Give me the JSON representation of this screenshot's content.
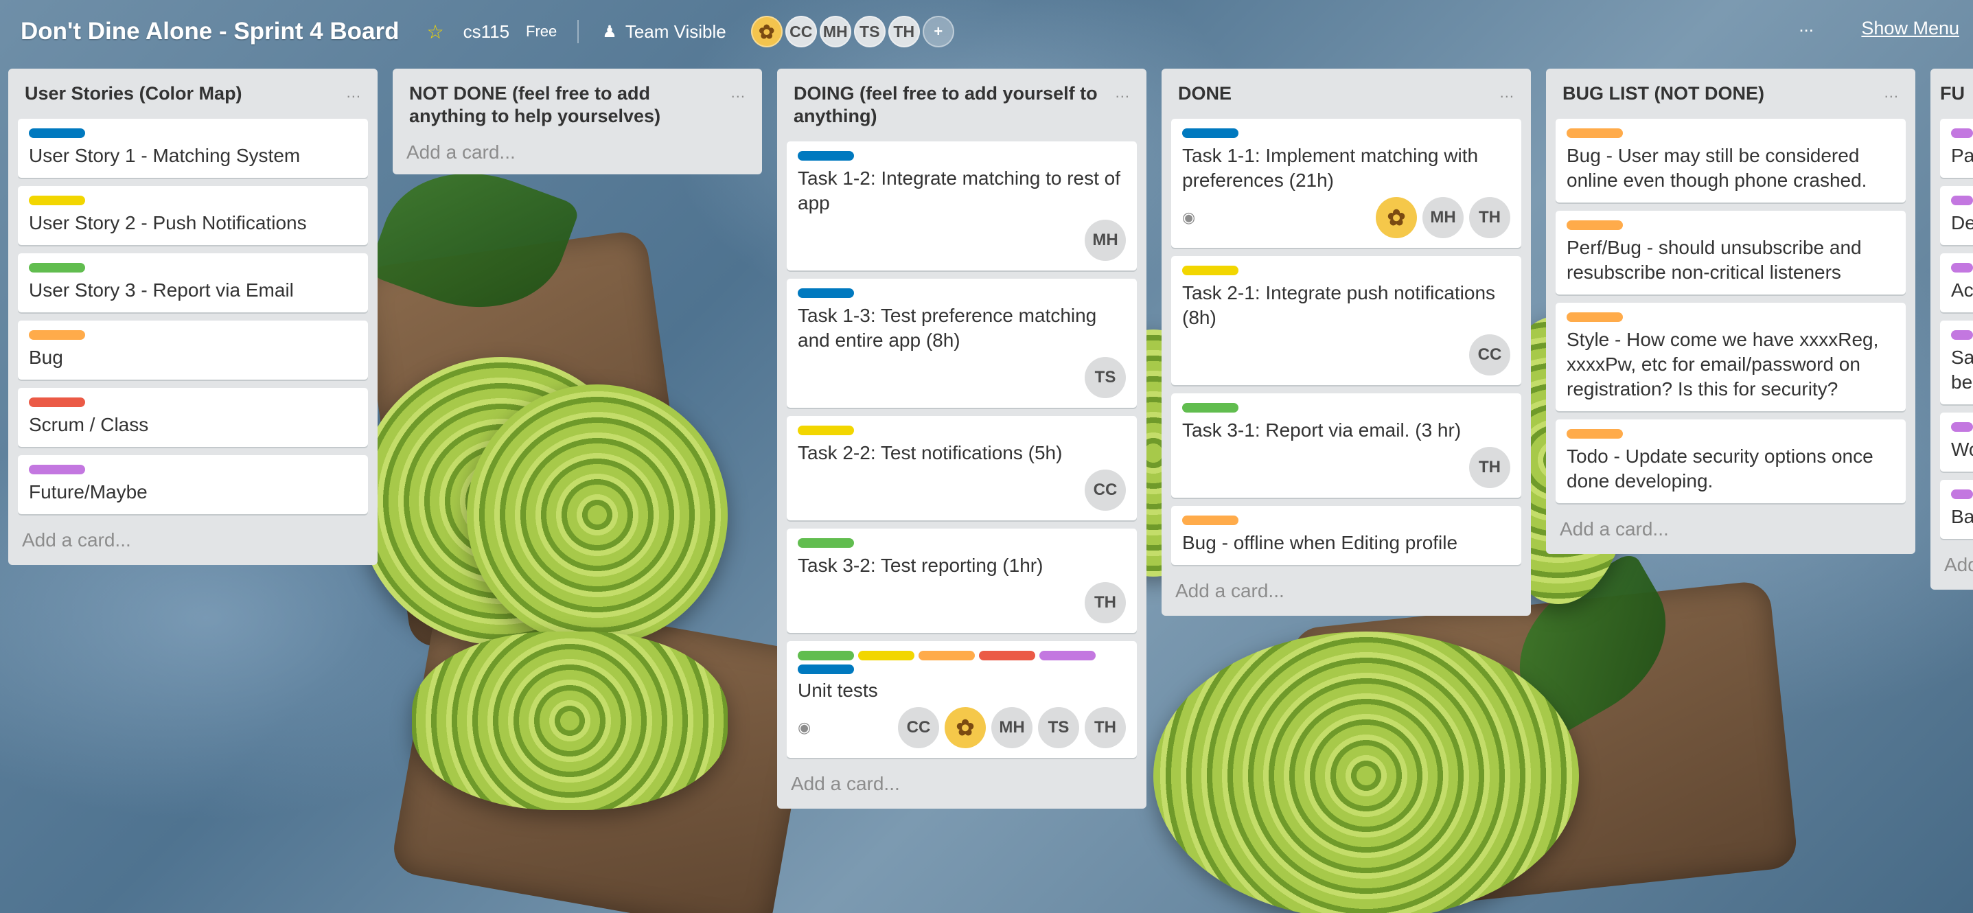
{
  "header": {
    "board_title": "Don't Dine Alone - Sprint 4 Board",
    "team_name": "cs115",
    "plan_badge": "Free",
    "visibility": "Team Visible",
    "menu_dots": "...",
    "show_menu": "Show Menu",
    "members": [
      "CC",
      "MH",
      "TS",
      "TH"
    ]
  },
  "colors": {
    "blue": "#0079bf",
    "yellow": "#f2d600",
    "green": "#61bd4f",
    "orange": "#ffab4a",
    "red": "#eb5a46",
    "purple": "#c377e0"
  },
  "lists": [
    {
      "title": "User Stories (Color Map)",
      "menu": "...",
      "add_card": "Add a card...",
      "cards": [
        {
          "title": "User Story 1 - Matching System"
        },
        {
          "title": "User Story 2 - Push Notifications"
        },
        {
          "title": "User Story 3 - Report via Email"
        },
        {
          "title": "Bug"
        },
        {
          "title": "Scrum / Class"
        },
        {
          "title": "Future/Maybe"
        }
      ]
    },
    {
      "title": "NOT DONE (feel free to add anything to help yourselves)",
      "menu": "...",
      "add_card": "Add a card..."
    },
    {
      "title": "DOING (feel free to add yourself to anything)",
      "menu": "...",
      "add_card": "Add a card...",
      "cards": [
        {
          "title": "Task 1-2: Integrate matching to rest of app",
          "members": [
            "MH"
          ]
        },
        {
          "title": "Task 1-3: Test preference matching and entire app (8h)",
          "members": [
            "TS"
          ]
        },
        {
          "title": "Task 2-2: Test notifications (5h)",
          "members": [
            "CC"
          ]
        },
        {
          "title": "Task 3-2: Test reporting (1hr)",
          "members": [
            "TH"
          ]
        },
        {
          "title": "Unit tests",
          "members": [
            "CC",
            "MH",
            "TS",
            "TH"
          ]
        }
      ]
    },
    {
      "title": "DONE",
      "menu": "...",
      "add_card": "Add a card...",
      "cards": [
        {
          "title": "Task 1-1: Implement matching with preferences (21h)",
          "members": [
            "MH",
            "TH"
          ]
        },
        {
          "title": "Task 2-1: Integrate push notifications (8h)",
          "members": [
            "CC"
          ]
        },
        {
          "title": "Task 3-1: Report via email. (3 hr)",
          "members": [
            "TH"
          ]
        },
        {
          "title": "Bug - offline when Editing profile"
        }
      ]
    },
    {
      "title": "BUG LIST (NOT DONE)",
      "menu": "...",
      "add_card": "Add a card...",
      "cards": [
        {
          "title": "Bug - User may still be considered online even though phone crashed."
        },
        {
          "title": "Perf/Bug - should unsubscribe and resubscribe non-critical listeners"
        },
        {
          "title": "Style - How come we have xxxxReg, xxxxPw, etc for email/password on registration? Is this for security?"
        },
        {
          "title": "Todo - Update security options once done developing."
        }
      ]
    },
    {
      "title": "FU",
      "add_card": "Add",
      "cards": [
        {
          "title": "Pa"
        },
        {
          "title": "De"
        },
        {
          "title": "Ac"
        },
        {
          "title": "Sa"
        },
        {
          "title": "be"
        },
        {
          "title": "Wo"
        },
        {
          "title": "Ba"
        }
      ]
    }
  ]
}
